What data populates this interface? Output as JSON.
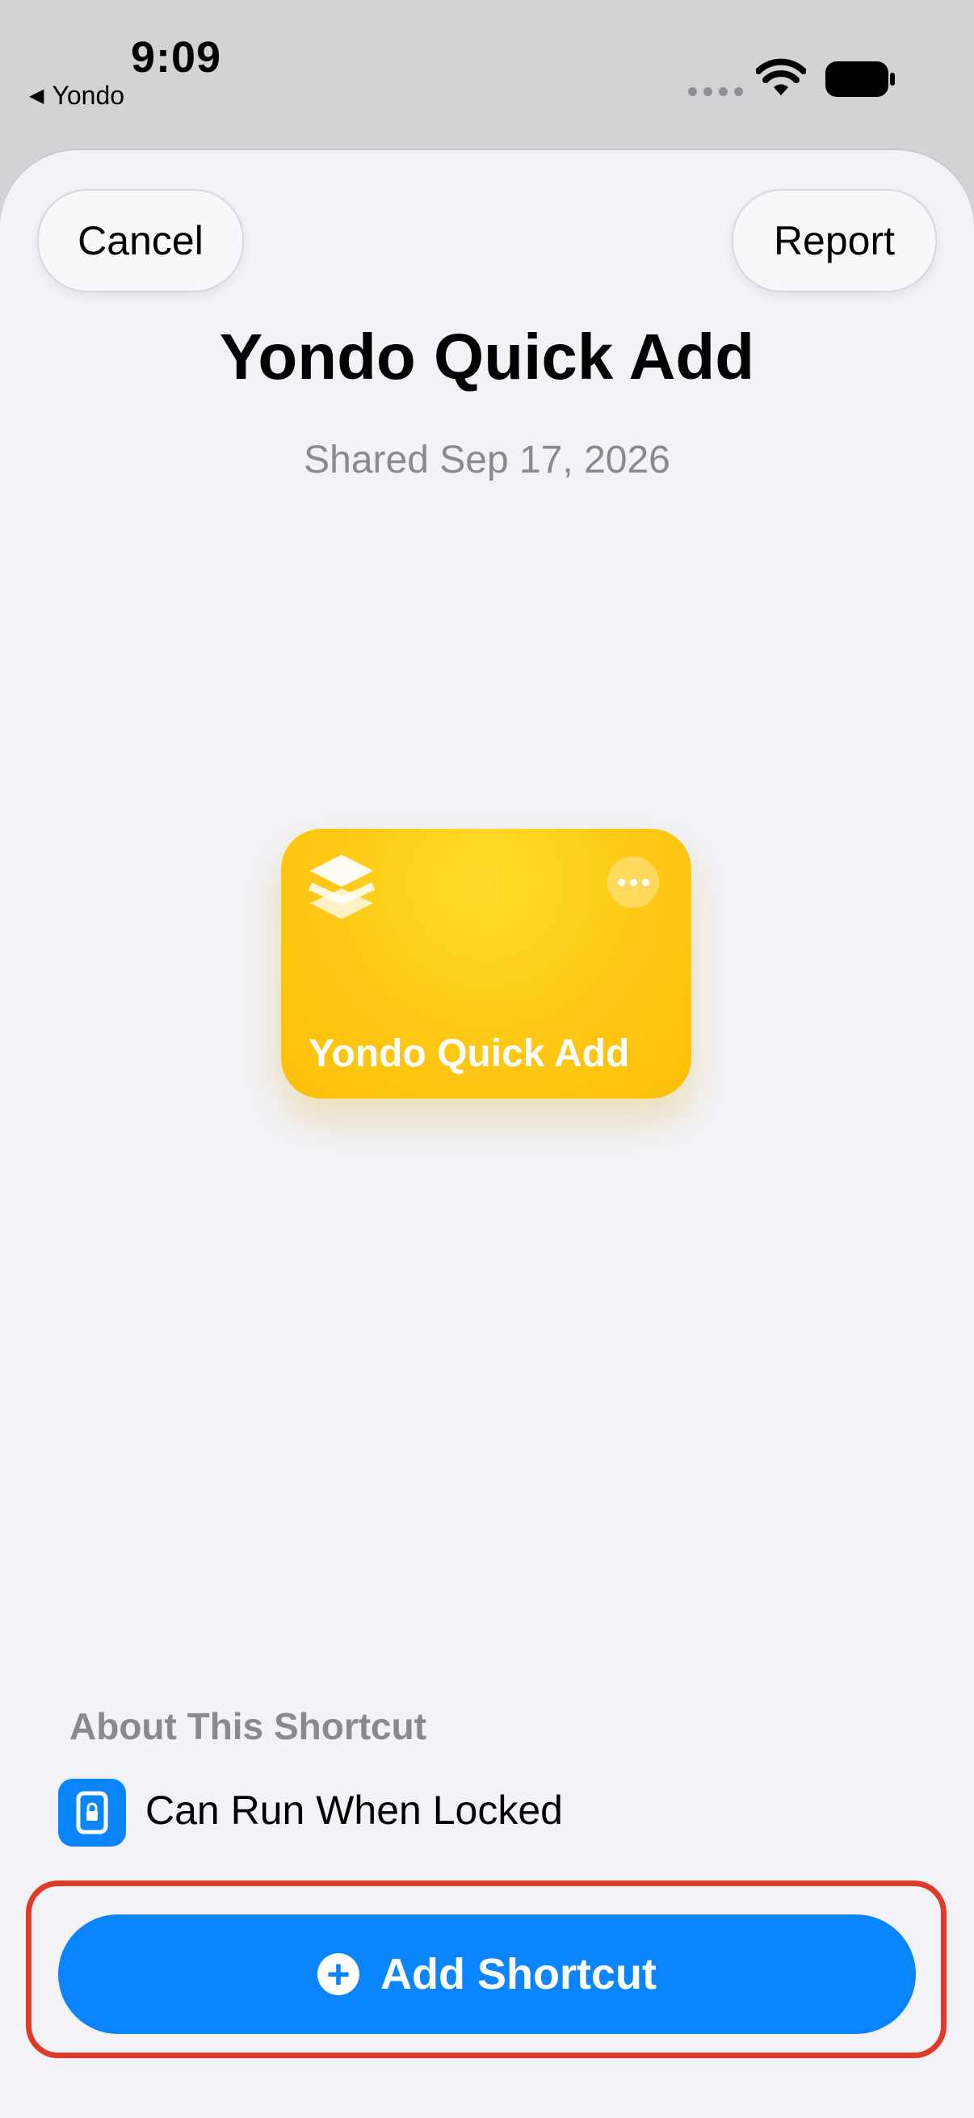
{
  "status_bar": {
    "time": "9:09",
    "back_app": "Yondo",
    "back_glyph": "◀"
  },
  "header": {
    "cancel_label": "Cancel",
    "report_label": "Report"
  },
  "shortcut": {
    "title": "Yondo Quick Add",
    "shared_text": "Shared Sep 17, 2026",
    "card_name": "Yondo Quick Add",
    "card_color": "#FFC814",
    "card_icon": "stack-icon"
  },
  "about": {
    "heading": "About This Shortcut",
    "features": [
      {
        "icon": "lock-icon",
        "label": "Can Run When Locked"
      }
    ]
  },
  "action": {
    "add_label": "Add Shortcut",
    "plus_glyph": "+",
    "button_color": "#0A84FF",
    "highlight_color": "#E03A2A"
  }
}
